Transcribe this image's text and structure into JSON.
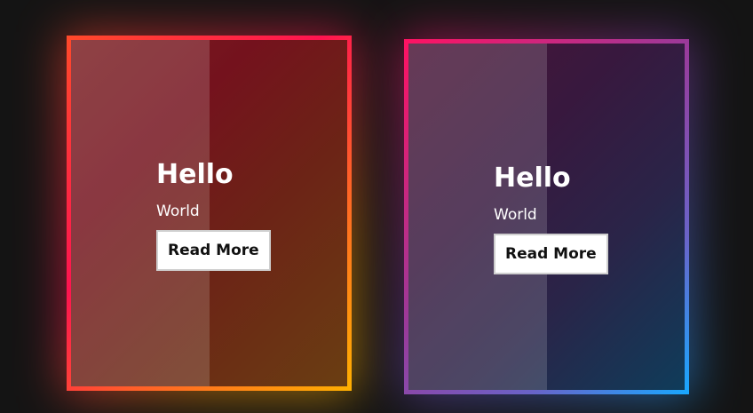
{
  "cards": [
    {
      "title": "Hello",
      "subtitle": "World",
      "button_label": "Read More",
      "border_colors": [
        "#ff4a2a",
        "#ff1450",
        "#ffb000"
      ]
    },
    {
      "title": "Hello",
      "subtitle": "World",
      "button_label": "Read More",
      "border_colors": [
        "#ff1262",
        "#9a3a9a",
        "#18a8ff"
      ]
    }
  ]
}
